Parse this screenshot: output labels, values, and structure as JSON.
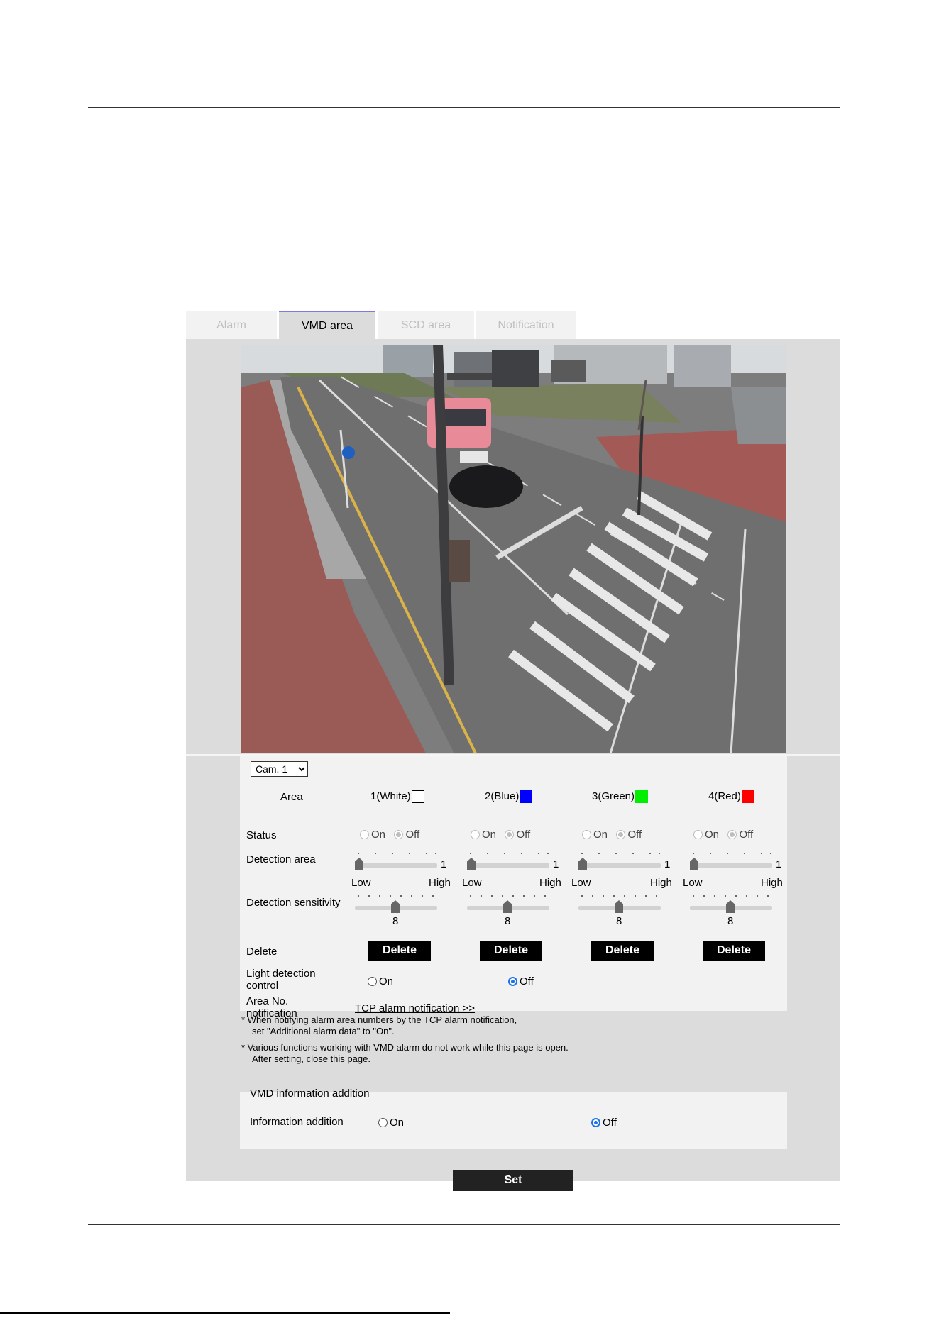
{
  "tabs": [
    {
      "label": "Alarm",
      "active": false
    },
    {
      "label": "VMD area",
      "active": true
    },
    {
      "label": "SCD area",
      "active": false
    },
    {
      "label": "Notification",
      "active": false
    }
  ],
  "camera_select": {
    "value": "Cam. 1",
    "options": [
      "Cam. 1"
    ]
  },
  "area_label": "Area",
  "areas": [
    {
      "name": "1(White)",
      "color": "#ffffff",
      "status": "off",
      "detection_area": "1",
      "sensitivity": "8",
      "delete_label": "Delete"
    },
    {
      "name": "2(Blue)",
      "color": "#0000ff",
      "status": "off",
      "detection_area": "1",
      "sensitivity": "8",
      "delete_label": "Delete"
    },
    {
      "name": "3(Green)",
      "color": "#00ee00",
      "status": "off",
      "detection_area": "1",
      "sensitivity": "8",
      "delete_label": "Delete"
    },
    {
      "name": "4(Red)",
      "color": "#ff0000",
      "status": "off",
      "detection_area": "1",
      "sensitivity": "8",
      "delete_label": "Delete"
    }
  ],
  "rows": {
    "status": "Status",
    "detection_area": "Detection area",
    "detection_sensitivity": "Detection sensitivity",
    "delete": "Delete",
    "light_detection_line1": "Light detection",
    "light_detection_line2": "control",
    "area_no_line1": "Area No.",
    "area_no_line2": "notification"
  },
  "radio": {
    "on": "On",
    "off": "Off"
  },
  "sensitivity": {
    "low": "Low",
    "high": "High"
  },
  "light_detection_value": "off",
  "tcp_link": "TCP alarm notification >>",
  "notes": [
    {
      "line1": "* When notifying alarm area numbers by the TCP alarm notification,",
      "line2": "set \"Additional alarm data\" to \"On\"."
    },
    {
      "line1": "* Various functions working with VMD alarm do not work while this page is open.",
      "line2": "After setting, close this page."
    }
  ],
  "vmd_info": {
    "title": "VMD information addition",
    "label": "Information addition",
    "value": "off"
  },
  "set_label": "Set"
}
